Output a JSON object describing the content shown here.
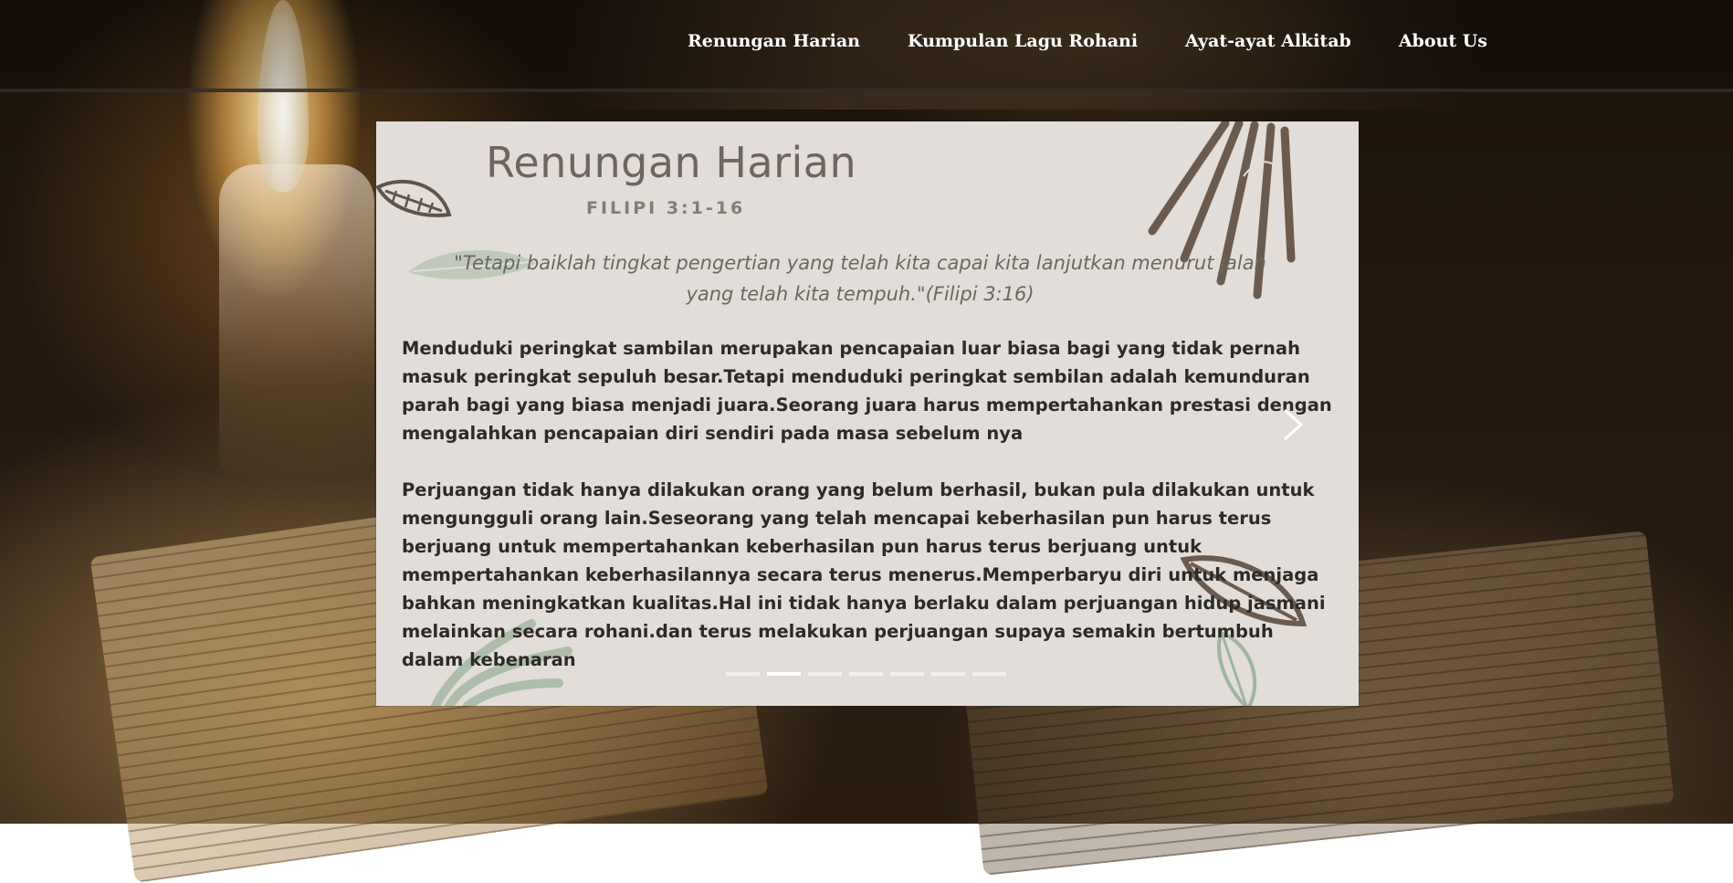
{
  "nav": {
    "items": [
      {
        "label": "Renungan Harian"
      },
      {
        "label": "Kumpulan Lagu Rohani"
      },
      {
        "label": "Ayat-ayat Alkitab"
      },
      {
        "label": "About Us"
      }
    ]
  },
  "slide": {
    "title": "Renungan Harian",
    "reference": "FILIPI 3:1-16",
    "quote_line1": "\"Tetapi baiklah tingkat pengertian yang telah kita capai kita lanjutkan menurut jalan",
    "quote_line2": "yang telah kita tempuh.\"(Filipi 3:16)",
    "paragraph1": "Menduduki peringkat sambilan merupakan pencapaian luar biasa bagi yang tidak pernah masuk peringkat sepuluh besar.Tetapi menduduki peringkat sembilan adalah kemunduran parah bagi yang biasa menjadi juara.Seorang juara harus mempertahankan prestasi dengan mengalahkan pencapaian diri sendiri pada masa sebelum nya",
    "paragraph2": "Perjuangan tidak hanya dilakukan orang yang belum berhasil, bukan pula dilakukan untuk mengungguli orang lain.Seseorang yang telah mencapai keberhasilan pun harus terus berjuang untuk mempertahankan keberhasilan pun harus terus berjuang untuk mempertahankan keberhasilannya secara terus menerus.Memperbaryu diri untuk menjaga bahkan meningkatkan kualitas.Hal ini tidak hanya berlaku dalam perjuangan hidup jasmani melainkan secara rohani.dan terus melakukan perjuangan supaya semakin bertumbuh dalam kebenaran"
  },
  "carousel": {
    "indicator_count": 7,
    "active_index": 1,
    "next_icon": "chevron-right-icon"
  },
  "colors": {
    "slide_bg": "#e2ddd8",
    "title": "#6e6560",
    "body_text": "#2d2a28",
    "leaf_green": "#9fb5a0",
    "leaf_brown": "#6b5b4e"
  }
}
